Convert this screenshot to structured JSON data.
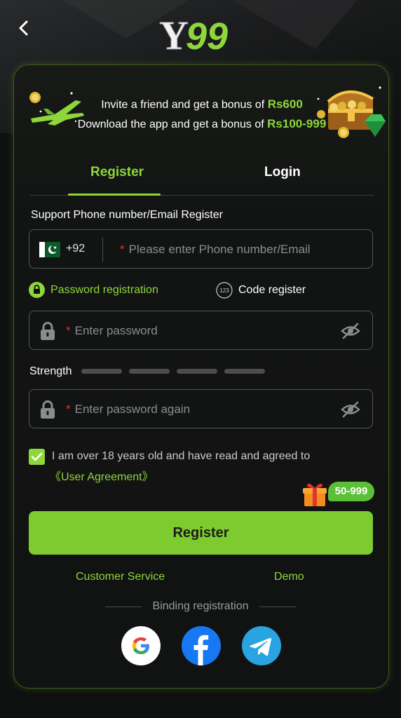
{
  "header": {
    "logo_text": "Y99"
  },
  "promo": {
    "line1_prefix": "Invite a friend and get a bonus of",
    "line1_amount": "Rs600",
    "line2_prefix": "Download the app and get a bonus of",
    "line2_amount": "Rs100-999"
  },
  "tabs": {
    "register": "Register",
    "login": "Login"
  },
  "form": {
    "section_title": "Support Phone number/Email Register",
    "country_code": "+92",
    "phone_placeholder": "Please enter Phone number/Email",
    "required_mark": "*",
    "mode_password": "Password registration",
    "mode_code": "Code register",
    "mode_code_icon_text": "123",
    "password_placeholder": "Enter password",
    "strength_label": "Strength",
    "strength_level": 0,
    "strength_segments": 4,
    "password_again_placeholder": "Enter password again",
    "agree_checked": true,
    "agree_text": "I am over 18 years old and have read and agreed to",
    "agree_link": "《User Agreement》",
    "bonus_badge": "50-999",
    "submit_label": "Register"
  },
  "links": {
    "customer_service": "Customer Service",
    "demo": "Demo"
  },
  "binding": {
    "title": "Binding registration",
    "providers": [
      "google",
      "facebook",
      "telegram"
    ]
  },
  "colors": {
    "accent": "#8fd63b",
    "button": "#7ecb2f",
    "background": "#0f1010",
    "required": "#e0342d"
  }
}
